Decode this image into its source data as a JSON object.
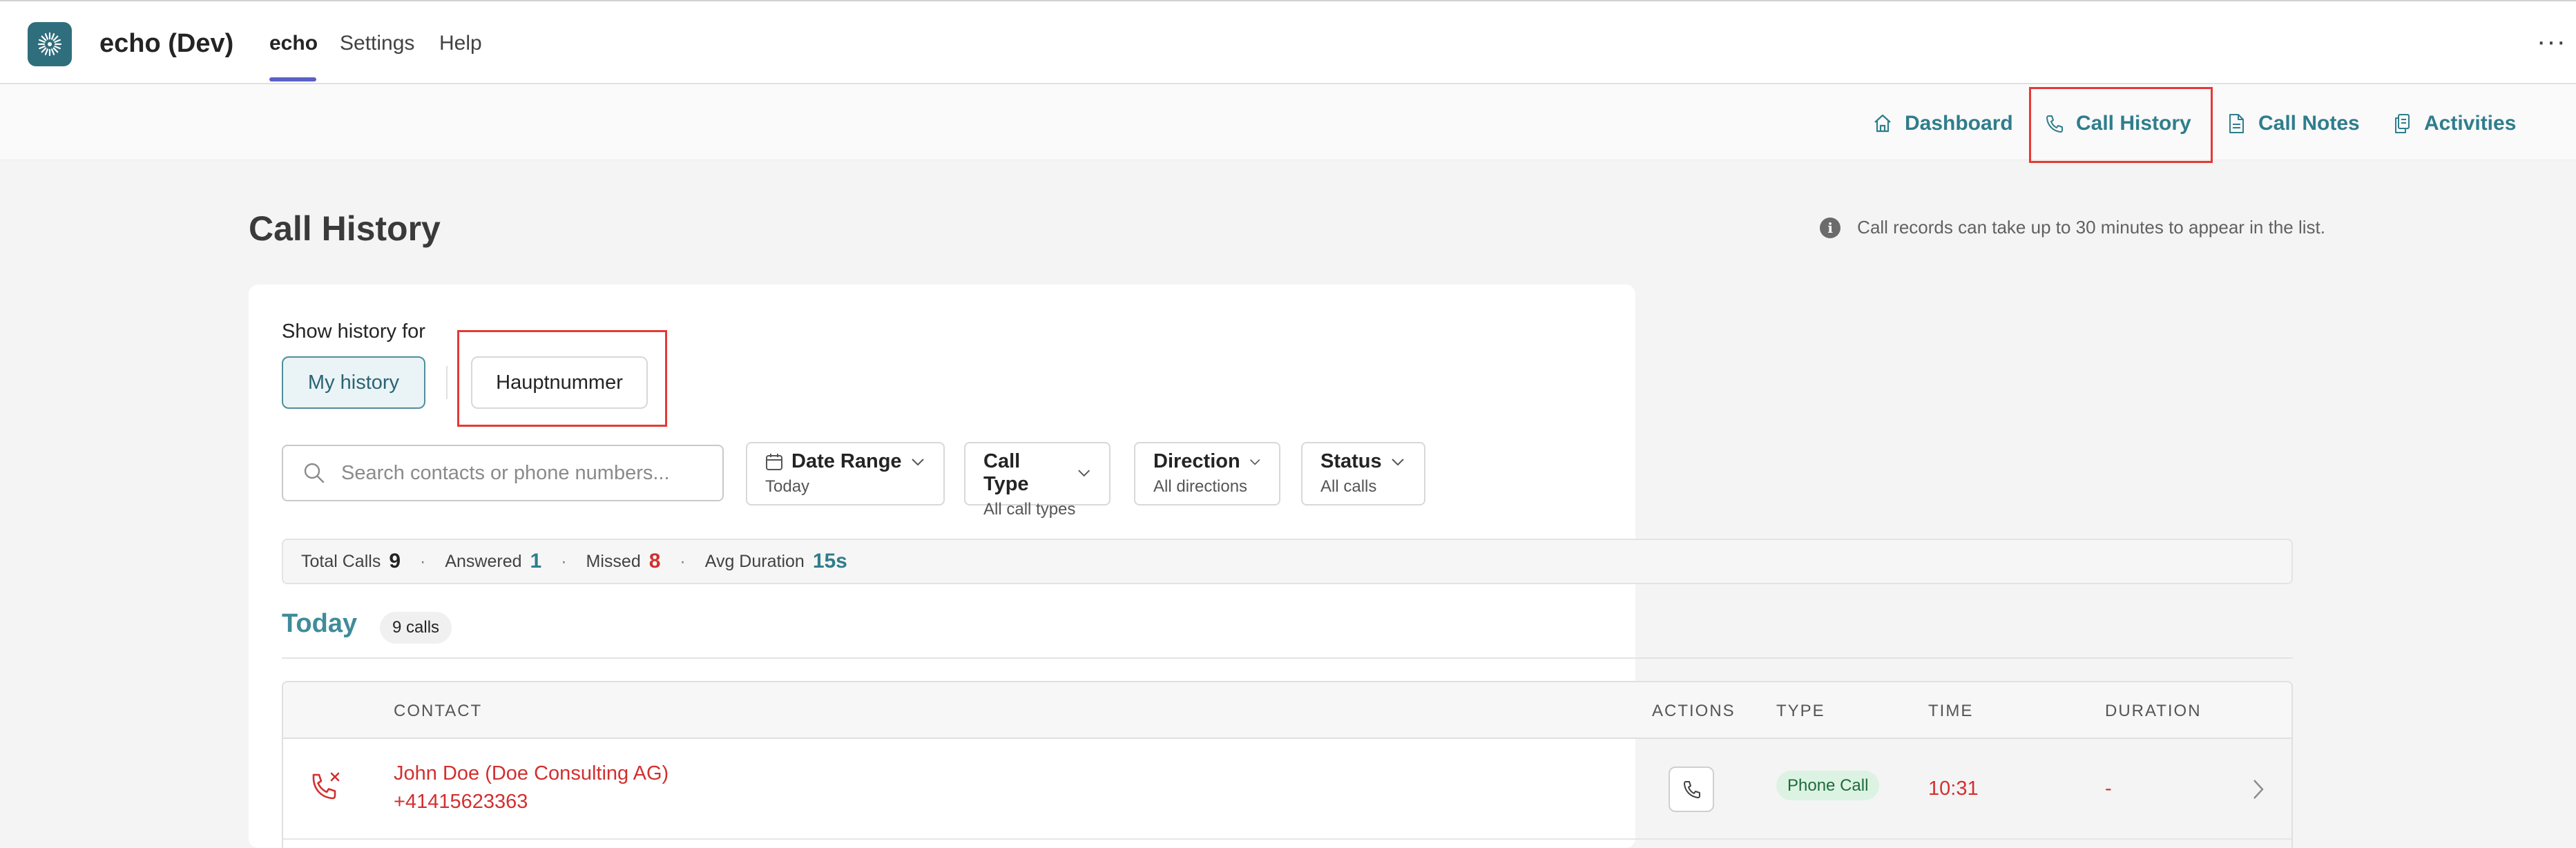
{
  "app": {
    "title": "echo (Dev)",
    "tabs": [
      {
        "label": "echo",
        "active": true
      },
      {
        "label": "Settings",
        "active": false
      },
      {
        "label": "Help",
        "active": false
      }
    ],
    "more_icon": "more-horizontal-icon"
  },
  "subnav": {
    "items": [
      {
        "label": "Dashboard",
        "icon": "home-icon"
      },
      {
        "label": "Call History",
        "icon": "phone-icon",
        "active": true
      },
      {
        "label": "Call Notes",
        "icon": "document-icon"
      },
      {
        "label": "Activities",
        "icon": "copy-icon"
      }
    ]
  },
  "page": {
    "title": "Call History",
    "info_note": "Call records can take up to 30 minutes to appear in the list."
  },
  "history": {
    "label": "Show history for",
    "options": [
      {
        "label": "My history",
        "selected": true
      },
      {
        "label": "Hauptnummer",
        "selected": false
      }
    ]
  },
  "search": {
    "placeholder": "Search contacts or phone numbers..."
  },
  "filters": [
    {
      "label": "Date Range",
      "value": "Today",
      "icon": "calendar-icon"
    },
    {
      "label": "Call Type",
      "value": "All call types"
    },
    {
      "label": "Direction",
      "value": "All directions"
    },
    {
      "label": "Status",
      "value": "All calls"
    }
  ],
  "stats": {
    "total_label": "Total Calls",
    "total_value": "9",
    "answered_label": "Answered",
    "answered_value": "1",
    "missed_label": "Missed",
    "missed_value": "8",
    "avg_label": "Avg Duration",
    "avg_value": "15s"
  },
  "group": {
    "label": "Today",
    "count": "9 calls"
  },
  "table": {
    "headers": {
      "contact": "CONTACT",
      "actions": "ACTIONS",
      "type": "TYPE",
      "time": "TIME",
      "duration": "DURATION"
    },
    "rows": [
      {
        "status_icon": "missed-call-icon",
        "name": "John Doe (Doe Consulting AG)",
        "number": "+41415623363",
        "type": "Phone Call",
        "time": "10:31",
        "duration": "-"
      }
    ]
  },
  "colors": {
    "accent": "#2f7d8c",
    "missed": "#d32f2f",
    "highlight_box": "#e53935",
    "tab_underline": "#5b5fc7"
  }
}
